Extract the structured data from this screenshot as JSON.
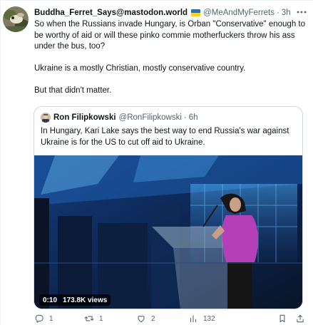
{
  "tweet": {
    "author": {
      "display_name": "Buddha_Ferret_Says@mastodon.world",
      "handle": "@MeAndMyFerrets",
      "time": "3h",
      "dot": "·"
    },
    "paragraphs": [
      "So when the Russians invade Hungary, is Orban \"Conservative\" enough to be worthy of aid or will these pinko commie motherfuckers throw his ass under the bus, too?",
      "Ukraine is a mostly Christian, mostly conservative country.",
      "But that didn't matter."
    ],
    "quote": {
      "display_name": "Ron Filipkowski",
      "handle": "@RonFilipkowski",
      "dot": "·",
      "time": "6h",
      "text": "In Hungary, Kari Lake says the best way to end Russia's war against Ukraine is for the US to cut off aid to Ukraine.",
      "video": {
        "duration": "0:10",
        "views": "173.8K views"
      }
    },
    "actions": {
      "replies": "1",
      "retweets": "1",
      "likes": "2",
      "views": "132"
    }
  },
  "icons": {
    "flag": "ukraine-flag-icon",
    "more": "more-icon",
    "reply": "reply-icon",
    "retweet": "retweet-icon",
    "like": "heart-icon",
    "views": "views-icon",
    "bookmark": "bookmark-icon",
    "share": "share-icon"
  },
  "colors": {
    "text": "#0f1419",
    "secondary": "#536471",
    "border": "#cfd9de",
    "flag_blue": "#1d6fd1",
    "flag_yellow": "#f7cf2b"
  }
}
